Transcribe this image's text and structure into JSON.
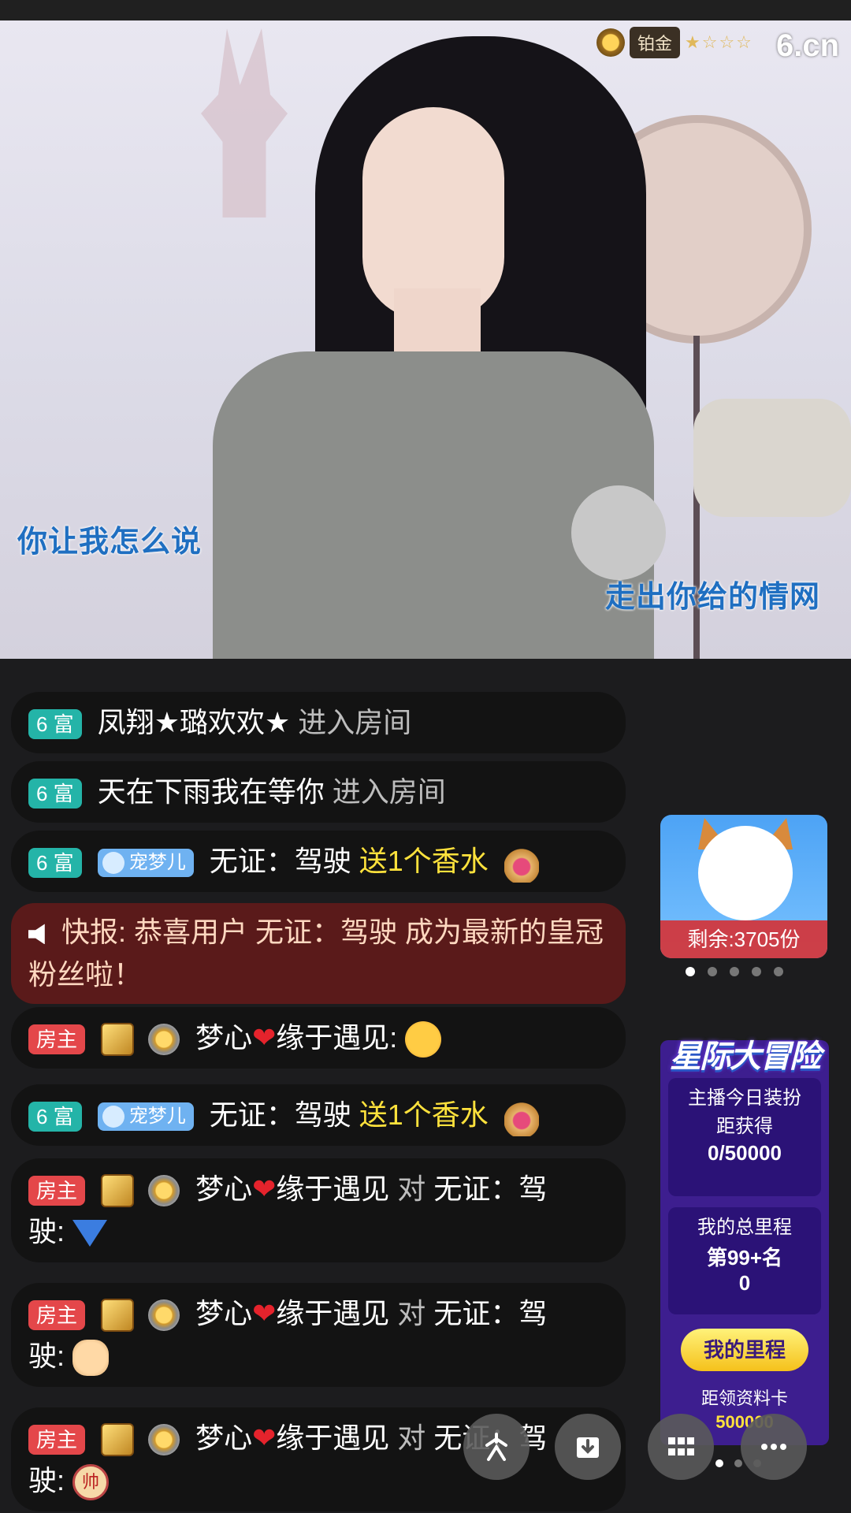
{
  "video": {
    "level_badge": "铂金",
    "level_stars": "★☆☆☆",
    "logo": "6.cn",
    "lyric_left": "你让我怎么说",
    "lyric_right": "走出你给的情网"
  },
  "chat": {
    "messages": [
      {
        "tag": "6 富",
        "user": "凤翔★璐欢欢★",
        "action": "进入房间"
      },
      {
        "tag": "6 富",
        "user": "天在下雨我在等你",
        "action": "进入房间"
      },
      {
        "tag": "6 富",
        "pet": "宠梦儿",
        "user": "无证：驾驶",
        "action": "送1个香水"
      },
      {
        "news": "快报: 恭喜用户 无证：驾驶 成为最新的皇冠粉丝啦！"
      },
      {
        "tag": "房主",
        "user_a": "梦心",
        "user_b": "缘于遇见:"
      },
      {
        "tag": "6 富",
        "pet": "宠梦儿",
        "user": "无证：驾驶",
        "action": "送1个香水"
      },
      {
        "tag": "房主",
        "user_a": "梦心",
        "user_b": "缘于遇见",
        "to": "对",
        "target": "无证：驾",
        "target2": "驶:"
      },
      {
        "tag": "房主",
        "user_a": "梦心",
        "user_b": "缘于遇见",
        "to": "对",
        "target": "无证：驾",
        "target2": "驶:"
      },
      {
        "tag": "房主",
        "user_a": "梦心",
        "user_b": "缘于遇见",
        "to": "对",
        "target": "无证：驾",
        "target2": "驶:",
        "emoji_text": "帅"
      }
    ]
  },
  "promo": {
    "remaining": "剩余:3705份"
  },
  "adventure": {
    "title": "星际大冒险",
    "card1_line1": "主播今日装扮",
    "card1_line2": "距获得",
    "card1_value": "0/50000",
    "card2_line1": "我的总里程",
    "card2_rank": "第99+名",
    "card2_value": "0",
    "button": "我的里程",
    "foot_label": "距领资料卡",
    "foot_value": "500000"
  },
  "icons": [
    "share-icon",
    "download-icon",
    "grid-icon",
    "more-icon",
    "speaker-icon"
  ]
}
